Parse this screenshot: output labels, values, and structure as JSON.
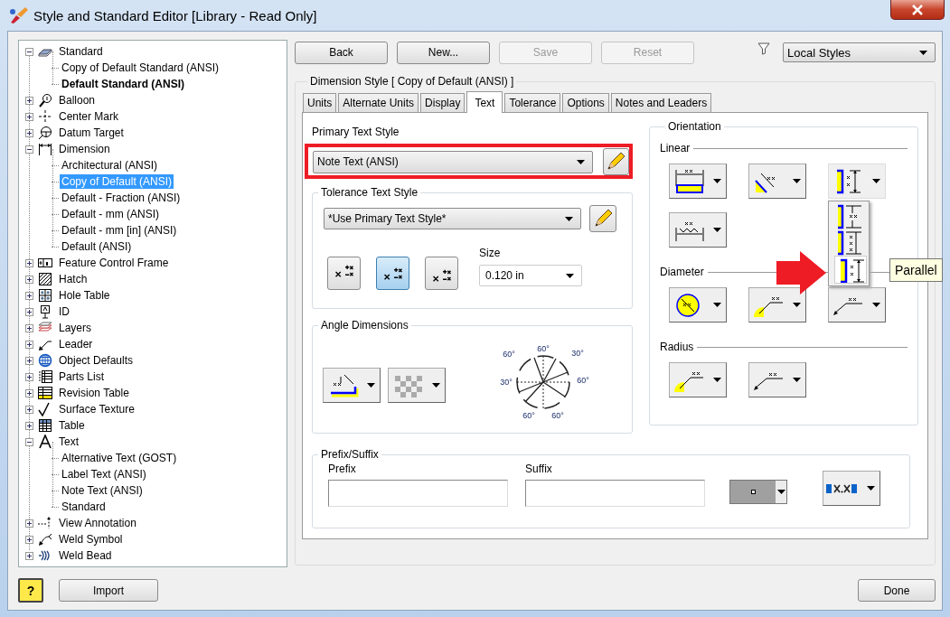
{
  "window": {
    "title": "Style and Standard Editor [Library - Read Only]"
  },
  "tree": [
    {
      "label": "Standard",
      "kind": "standard",
      "expanded": true,
      "selected": false,
      "children": [
        {
          "label": "Copy of Default Standard (ANSI)",
          "active": false,
          "selected": false
        },
        {
          "label": "Default Standard (ANSI)",
          "active": true,
          "selected": false
        }
      ]
    },
    {
      "label": "Balloon",
      "kind": "balloon",
      "expanded": false,
      "selected": false
    },
    {
      "label": "Center Mark",
      "kind": "center-mark",
      "expanded": false,
      "selected": false
    },
    {
      "label": "Datum Target",
      "kind": "datum-target",
      "expanded": false,
      "selected": false
    },
    {
      "label": "Dimension",
      "kind": "dimension",
      "expanded": true,
      "selected": false,
      "children": [
        {
          "label": "Architectural (ANSI)",
          "active": false,
          "selected": false
        },
        {
          "label": "Copy of Default (ANSI)",
          "active": false,
          "selected": true
        },
        {
          "label": "Default - Fraction (ANSI)",
          "active": false,
          "selected": false
        },
        {
          "label": "Default - mm (ANSI)",
          "active": false,
          "selected": false
        },
        {
          "label": "Default - mm [in] (ANSI)",
          "active": false,
          "selected": false
        },
        {
          "label": "Default (ANSI)",
          "active": false,
          "selected": false
        }
      ]
    },
    {
      "label": "Feature Control Frame",
      "kind": "fcf",
      "expanded": false,
      "selected": false
    },
    {
      "label": "Hatch",
      "kind": "hatch",
      "expanded": false,
      "selected": false
    },
    {
      "label": "Hole Table",
      "kind": "hole-table",
      "expanded": false,
      "selected": false
    },
    {
      "label": "ID",
      "kind": "id",
      "expanded": false,
      "selected": false
    },
    {
      "label": "Layers",
      "kind": "layers",
      "expanded": false,
      "selected": false
    },
    {
      "label": "Leader",
      "kind": "leader",
      "expanded": false,
      "selected": false
    },
    {
      "label": "Object Defaults",
      "kind": "object-defaults",
      "expanded": false,
      "selected": false
    },
    {
      "label": "Parts List",
      "kind": "parts-list",
      "expanded": false,
      "selected": false
    },
    {
      "label": "Revision Table",
      "kind": "revision-table",
      "expanded": false,
      "selected": false
    },
    {
      "label": "Surface Texture",
      "kind": "surface-texture",
      "expanded": false,
      "selected": false
    },
    {
      "label": "Table",
      "kind": "table",
      "expanded": false,
      "selected": false
    },
    {
      "label": "Text",
      "kind": "text",
      "expanded": true,
      "selected": false,
      "children": [
        {
          "label": "Alternative Text (GOST)",
          "active": false,
          "selected": false
        },
        {
          "label": "Label Text (ANSI)",
          "active": false,
          "selected": false
        },
        {
          "label": "Note Text (ANSI)",
          "active": false,
          "selected": false
        },
        {
          "label": "Standard",
          "active": false,
          "selected": false
        }
      ]
    },
    {
      "label": "View Annotation",
      "kind": "view-annotation",
      "expanded": false,
      "selected": false
    },
    {
      "label": "Weld Symbol",
      "kind": "weld-symbol",
      "expanded": false,
      "selected": false
    },
    {
      "label": "Weld Bead",
      "kind": "weld-bead",
      "expanded": false,
      "selected": false
    }
  ],
  "toolbar": {
    "buttons": [
      {
        "label": "Back",
        "disabled": false
      },
      {
        "label": "New...",
        "disabled": false
      },
      {
        "label": "Save",
        "disabled": true
      },
      {
        "label": "Reset",
        "disabled": true
      }
    ],
    "filter": "Local Styles"
  },
  "style_group": {
    "title": "Dimension Style [ Copy of Default (ANSI) ]"
  },
  "tabs": [
    {
      "label": "Units",
      "selected": false
    },
    {
      "label": "Alternate Units",
      "selected": false
    },
    {
      "label": "Display",
      "selected": false
    },
    {
      "label": "Text",
      "selected": true
    },
    {
      "label": "Tolerance",
      "selected": false
    },
    {
      "label": "Options",
      "selected": false
    },
    {
      "label": "Notes and Leaders",
      "selected": false
    }
  ],
  "primary_text_style": {
    "label": "Primary Text Style",
    "value": "Note Text (ANSI)",
    "highlighted": true
  },
  "tolerance_text_style": {
    "label": "Tolerance Text Style",
    "value": "*Use Primary Text Style*",
    "formats": [
      {
        "kind": "high",
        "selected": false
      },
      {
        "kind": "center",
        "selected": true
      },
      {
        "kind": "low",
        "selected": false
      }
    ],
    "size_label": "Size",
    "size_value": "0.120 in"
  },
  "angle_dimensions": {
    "label": "Angle Dimensions",
    "buttons": [
      {
        "kind": "angle"
      },
      {
        "kind": "checker"
      }
    ],
    "diagram_labels": [
      "60°",
      "30°",
      "60°",
      "60°",
      "30°",
      "60°",
      "60°"
    ]
  },
  "orientation": {
    "label": "Orientation",
    "sections": [
      {
        "label": "Linear",
        "buttons": [
          {
            "kind": "horizontal",
            "open": false
          },
          {
            "kind": "aligned",
            "open": false
          },
          {
            "kind": "parallel",
            "open": true,
            "menu": {
              "options": [
                {
                  "kind": "above",
                  "selected": false
                },
                {
                  "kind": "stacked",
                  "selected": false
                },
                {
                  "kind": "parallel",
                  "selected": true
                }
              ],
              "tooltip": "Parallel"
            }
          },
          {
            "kind": "stacked-dim",
            "open": false
          }
        ]
      },
      {
        "label": "Diameter",
        "buttons": [
          {
            "kind": "circle",
            "open": false
          },
          {
            "kind": "arc-leader",
            "open": false
          },
          {
            "kind": "leader",
            "open": false
          }
        ]
      },
      {
        "label": "Radius",
        "buttons": [
          {
            "kind": "arc-leader",
            "open": false
          },
          {
            "kind": "leader",
            "open": false
          }
        ]
      }
    ]
  },
  "callout_arrow": true,
  "prefix_suffix": {
    "label": "Prefix/Suffix",
    "prefix_label": "Prefix",
    "suffix_label": "Suffix"
  },
  "footer": {
    "help": "?",
    "import": "Import",
    "done": "Done"
  }
}
